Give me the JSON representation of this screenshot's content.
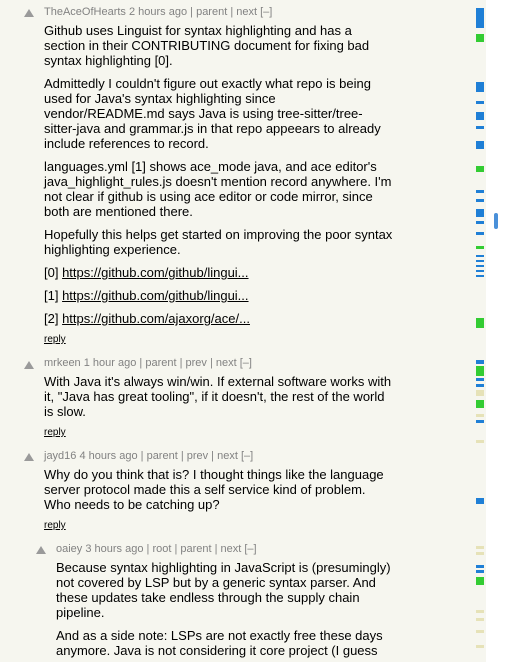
{
  "comments": [
    {
      "user": "TheAceOfHearts",
      "age": "2 hours ago",
      "links": "| parent | next [–]",
      "paragraphs": [
        "Github uses Linguist for syntax highlighting and has a section in their CONTRIBUTING document for fixing bad syntax highlighting [0].",
        "Admittedly I couldn't figure out exactly what repo is being used for Java's syntax highlighting since vendor/README.md says Java is using tree-sitter/tree-sitter-java and grammar.js in that repo appeears to already include references to record.",
        "languages.yml [1] shows ace_mode java, and ace editor's java_highlight_rules.js doesn't mention record anywhere. I'm not clear if github is using ace editor or code mirror, since both are mentioned there.",
        "Hopefully this helps get started on improving the poor syntax highlighting experience."
      ],
      "refs": [
        {
          "label": "[0] ",
          "url": "https://github.com/github/lingui..."
        },
        {
          "label": "[1] ",
          "url": "https://github.com/github/lingui..."
        },
        {
          "label": "[2] ",
          "url": "https://github.com/ajaxorg/ace/..."
        }
      ],
      "reply": "reply"
    },
    {
      "user": "mrkeen",
      "age": "1 hour ago",
      "links": "| parent | prev | next [–]",
      "paragraphs": [
        "With Java it's always win/win. If external software works with it, \"Java has great tooling\", if it doesn't, the rest of the world is slow."
      ],
      "reply": "reply"
    },
    {
      "user": "jayd16",
      "age": "4 hours ago",
      "links": "| parent | prev | next [–]",
      "paragraphs": [
        "Why do you think that is? I thought things like the language server protocol made this a self service kind of problem. Who needs to be catching up?"
      ],
      "reply": "reply"
    },
    {
      "user": "oaiey",
      "age": "3 hours ago",
      "links": "| root | parent | next [–]",
      "paragraphs": [
        "Because syntax highlighting in JavaScript is (presumingly) not covered by LSP but by a generic syntax parser. And these updates take endless through the supply chain pipeline.",
        "And as a side note: LSPs are not exactly free these days anymore. Java is not considering it core project (I guess"
      ]
    }
  ],
  "colors": {
    "page_bg": "#f6f6ef",
    "meta_text": "#828282",
    "minimap_blue": "#1f7fd6",
    "minimap_green": "#33cc33",
    "minimap_beige": "#e6e2b8",
    "scroll_thumb": "#4a90d9"
  },
  "icons": {
    "vote": "upvote-arrow-icon"
  }
}
